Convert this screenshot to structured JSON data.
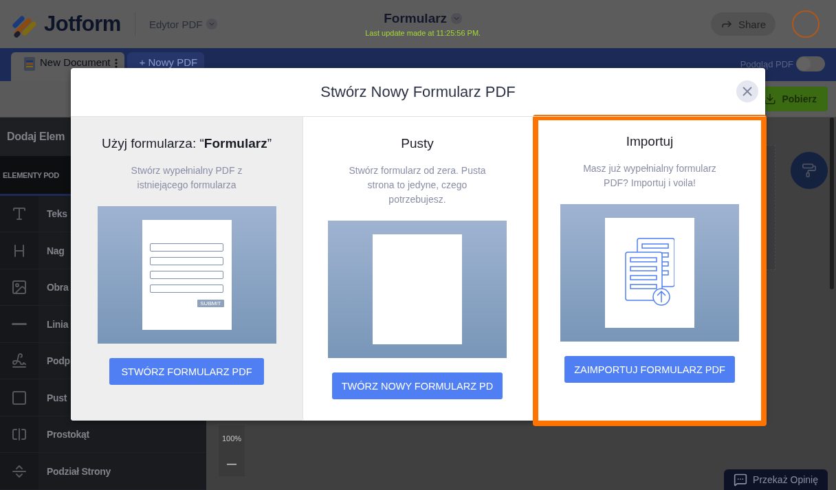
{
  "header": {
    "logo_text": "Jotform",
    "app_menu": "Edytor PDF",
    "form_title": "Formularz",
    "last_update": "Last update made at 11:25:56 PM.",
    "share_button": "Share"
  },
  "tabs": [
    {
      "label": "New Document",
      "selected": true
    },
    {
      "label": "+ Nowy PDF",
      "selected": false
    }
  ],
  "preview_toggle": {
    "label": "Podgląd PDF",
    "on": false
  },
  "download_button": "Pobierz",
  "sidebar": {
    "title": "Dodaj Elem",
    "section": "ELEMENTY POD",
    "items": [
      {
        "kind": "text",
        "label": "Teks"
      },
      {
        "kind": "heading",
        "label": "Nag"
      },
      {
        "kind": "image",
        "label": "Obra"
      },
      {
        "kind": "line",
        "label": "Linia"
      },
      {
        "kind": "signature",
        "label": "Podp"
      },
      {
        "kind": "blank",
        "label": "Pust"
      },
      {
        "kind": "rectangle",
        "label": "Prostokąt"
      },
      {
        "kind": "pagebreak",
        "label": "Podział Strony"
      }
    ]
  },
  "zoom": {
    "level_text": "100%",
    "zoom_out": "—"
  },
  "feedback_button": "Przekaż Opinię",
  "modal": {
    "title": "Stwórz Nowy Formularz PDF",
    "options": [
      {
        "kind": "form",
        "title": "Użyj formularza: “**Formularz**”",
        "description": "Stwórz wypełnialny PDF z istniejącego formularza",
        "preview_button": "SUBMIT",
        "button": "STWÓRZ FORMULARZ PDF",
        "shaded": true,
        "highlighted": false
      },
      {
        "kind": "blank",
        "title": "Pusty",
        "description": "Stwórz formularz od zera. Pusta strona to jedyne, czego potrzebujesz.",
        "button": "TWÓRZ NOWY FORMULARZ PD",
        "shaded": false,
        "highlighted": false
      },
      {
        "kind": "import",
        "title": "Importuj",
        "description": "Masz już wypełnialny formularz PDF? Importuj i voila!",
        "button": "ZAIMPORTUJ FORMULARZ PDF",
        "shaded": false,
        "highlighted": true
      }
    ]
  }
}
